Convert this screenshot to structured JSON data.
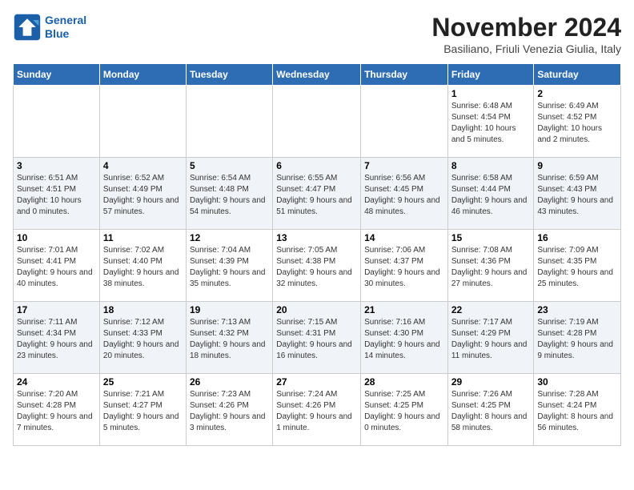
{
  "logo": {
    "line1": "General",
    "line2": "Blue"
  },
  "title": "November 2024",
  "subtitle": "Basiliano, Friuli Venezia Giulia, Italy",
  "weekdays": [
    "Sunday",
    "Monday",
    "Tuesday",
    "Wednesday",
    "Thursday",
    "Friday",
    "Saturday"
  ],
  "weeks": [
    [
      {
        "day": "",
        "info": ""
      },
      {
        "day": "",
        "info": ""
      },
      {
        "day": "",
        "info": ""
      },
      {
        "day": "",
        "info": ""
      },
      {
        "day": "",
        "info": ""
      },
      {
        "day": "1",
        "info": "Sunrise: 6:48 AM\nSunset: 4:54 PM\nDaylight: 10 hours and 5 minutes."
      },
      {
        "day": "2",
        "info": "Sunrise: 6:49 AM\nSunset: 4:52 PM\nDaylight: 10 hours and 2 minutes."
      }
    ],
    [
      {
        "day": "3",
        "info": "Sunrise: 6:51 AM\nSunset: 4:51 PM\nDaylight: 10 hours and 0 minutes."
      },
      {
        "day": "4",
        "info": "Sunrise: 6:52 AM\nSunset: 4:49 PM\nDaylight: 9 hours and 57 minutes."
      },
      {
        "day": "5",
        "info": "Sunrise: 6:54 AM\nSunset: 4:48 PM\nDaylight: 9 hours and 54 minutes."
      },
      {
        "day": "6",
        "info": "Sunrise: 6:55 AM\nSunset: 4:47 PM\nDaylight: 9 hours and 51 minutes."
      },
      {
        "day": "7",
        "info": "Sunrise: 6:56 AM\nSunset: 4:45 PM\nDaylight: 9 hours and 48 minutes."
      },
      {
        "day": "8",
        "info": "Sunrise: 6:58 AM\nSunset: 4:44 PM\nDaylight: 9 hours and 46 minutes."
      },
      {
        "day": "9",
        "info": "Sunrise: 6:59 AM\nSunset: 4:43 PM\nDaylight: 9 hours and 43 minutes."
      }
    ],
    [
      {
        "day": "10",
        "info": "Sunrise: 7:01 AM\nSunset: 4:41 PM\nDaylight: 9 hours and 40 minutes."
      },
      {
        "day": "11",
        "info": "Sunrise: 7:02 AM\nSunset: 4:40 PM\nDaylight: 9 hours and 38 minutes."
      },
      {
        "day": "12",
        "info": "Sunrise: 7:04 AM\nSunset: 4:39 PM\nDaylight: 9 hours and 35 minutes."
      },
      {
        "day": "13",
        "info": "Sunrise: 7:05 AM\nSunset: 4:38 PM\nDaylight: 9 hours and 32 minutes."
      },
      {
        "day": "14",
        "info": "Sunrise: 7:06 AM\nSunset: 4:37 PM\nDaylight: 9 hours and 30 minutes."
      },
      {
        "day": "15",
        "info": "Sunrise: 7:08 AM\nSunset: 4:36 PM\nDaylight: 9 hours and 27 minutes."
      },
      {
        "day": "16",
        "info": "Sunrise: 7:09 AM\nSunset: 4:35 PM\nDaylight: 9 hours and 25 minutes."
      }
    ],
    [
      {
        "day": "17",
        "info": "Sunrise: 7:11 AM\nSunset: 4:34 PM\nDaylight: 9 hours and 23 minutes."
      },
      {
        "day": "18",
        "info": "Sunrise: 7:12 AM\nSunset: 4:33 PM\nDaylight: 9 hours and 20 minutes."
      },
      {
        "day": "19",
        "info": "Sunrise: 7:13 AM\nSunset: 4:32 PM\nDaylight: 9 hours and 18 minutes."
      },
      {
        "day": "20",
        "info": "Sunrise: 7:15 AM\nSunset: 4:31 PM\nDaylight: 9 hours and 16 minutes."
      },
      {
        "day": "21",
        "info": "Sunrise: 7:16 AM\nSunset: 4:30 PM\nDaylight: 9 hours and 14 minutes."
      },
      {
        "day": "22",
        "info": "Sunrise: 7:17 AM\nSunset: 4:29 PM\nDaylight: 9 hours and 11 minutes."
      },
      {
        "day": "23",
        "info": "Sunrise: 7:19 AM\nSunset: 4:28 PM\nDaylight: 9 hours and 9 minutes."
      }
    ],
    [
      {
        "day": "24",
        "info": "Sunrise: 7:20 AM\nSunset: 4:28 PM\nDaylight: 9 hours and 7 minutes."
      },
      {
        "day": "25",
        "info": "Sunrise: 7:21 AM\nSunset: 4:27 PM\nDaylight: 9 hours and 5 minutes."
      },
      {
        "day": "26",
        "info": "Sunrise: 7:23 AM\nSunset: 4:26 PM\nDaylight: 9 hours and 3 minutes."
      },
      {
        "day": "27",
        "info": "Sunrise: 7:24 AM\nSunset: 4:26 PM\nDaylight: 9 hours and 1 minute."
      },
      {
        "day": "28",
        "info": "Sunrise: 7:25 AM\nSunset: 4:25 PM\nDaylight: 9 hours and 0 minutes."
      },
      {
        "day": "29",
        "info": "Sunrise: 7:26 AM\nSunset: 4:25 PM\nDaylight: 8 hours and 58 minutes."
      },
      {
        "day": "30",
        "info": "Sunrise: 7:28 AM\nSunset: 4:24 PM\nDaylight: 8 hours and 56 minutes."
      }
    ]
  ]
}
